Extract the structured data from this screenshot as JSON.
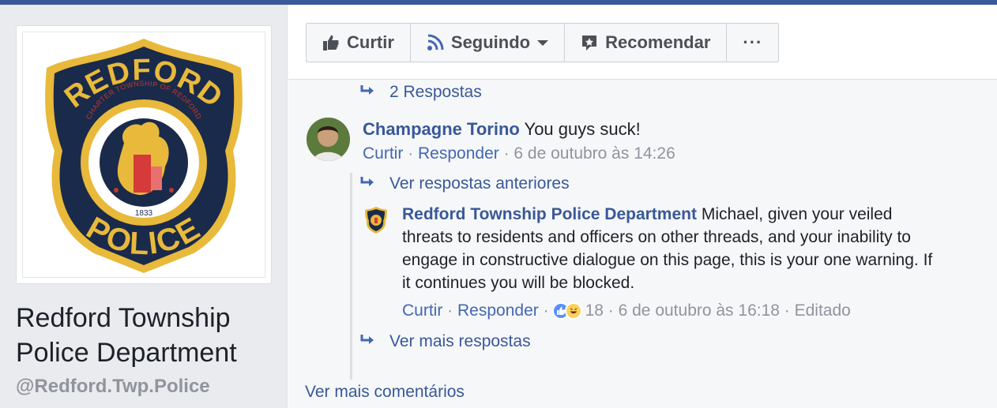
{
  "colors": {
    "brand": "#3b5998",
    "link": "#385898",
    "muted": "#90949c",
    "badge_gold": "#e8b93a",
    "badge_navy": "#1a2a4a"
  },
  "page": {
    "name": "Redford Township Police Department",
    "handle": "@Redford.Twp.Police",
    "logo": {
      "top_text": "REDFORD",
      "bottom_text": "POLICE",
      "ring_text": "CHARTER TOWNSHIP OF REDFORD",
      "year": "1833"
    }
  },
  "actions": {
    "like": {
      "label": "Curtir",
      "icon": "thumbs-up-icon"
    },
    "follow": {
      "label": "Seguindo",
      "icon": "rss-icon"
    },
    "recommend": {
      "label": "Recomendar",
      "icon": "recommend-icon"
    },
    "more": {
      "label": "···",
      "icon": "more-icon"
    }
  },
  "thread": {
    "replies_top": "2 Respostas",
    "comment": {
      "author": "Champagne Torino",
      "text": "You guys suck!",
      "like": "Curtir",
      "reply": "Responder",
      "time": "6 de outubro às 14:26"
    },
    "previous_replies": "Ver respostas anteriores",
    "reply": {
      "author": "Redford Township Police Department",
      "text": "Michael, given your veiled threats to residents and officers on other threads, and your inability to engage in constructive dialogue on this page, this is your one warning. If it continues you will be blocked.",
      "like": "Curtir",
      "reply": "Responder",
      "reaction_count": "18",
      "time": "6 de outubro às 16:18",
      "edited": "Editado",
      "reactions": [
        "like-icon",
        "haha-icon"
      ]
    },
    "more_replies": "Ver mais respostas",
    "more_comments": "Ver mais comentários"
  }
}
